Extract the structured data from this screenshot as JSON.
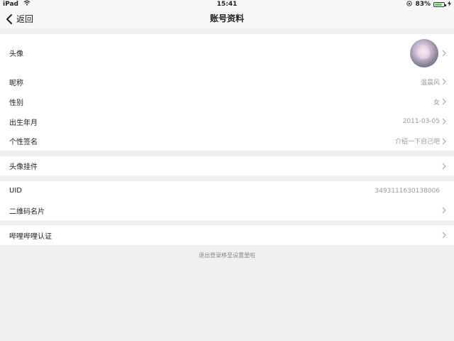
{
  "status": {
    "device": "iPad",
    "time": "15:41",
    "battery": "83%",
    "battery_level": 0.83
  },
  "nav": {
    "back_label": "返回",
    "title": "账号资料"
  },
  "profile": {
    "avatar_label": "头像",
    "nickname_label": "昵称",
    "nickname_value": "温晨风",
    "gender_label": "性别",
    "gender_value": "女",
    "birthday_label": "出生年月",
    "birthday_value": "2011-03-05",
    "signature_label": "个性签名",
    "signature_value": "介绍一下自己吧"
  },
  "pendant": {
    "label": "头像挂件"
  },
  "account": {
    "uid_label": "UID",
    "uid_value": "3493111630138006",
    "qrcode_label": "二维码名片"
  },
  "verify": {
    "label": "哔哩哔哩认证"
  },
  "footer": {
    "logout_note": "退出登录移至设置里啦"
  },
  "colors": {
    "background": "#f0f0f2",
    "row": "#ffffff",
    "secondary_text": "#999999",
    "battery": "#4cd964"
  }
}
